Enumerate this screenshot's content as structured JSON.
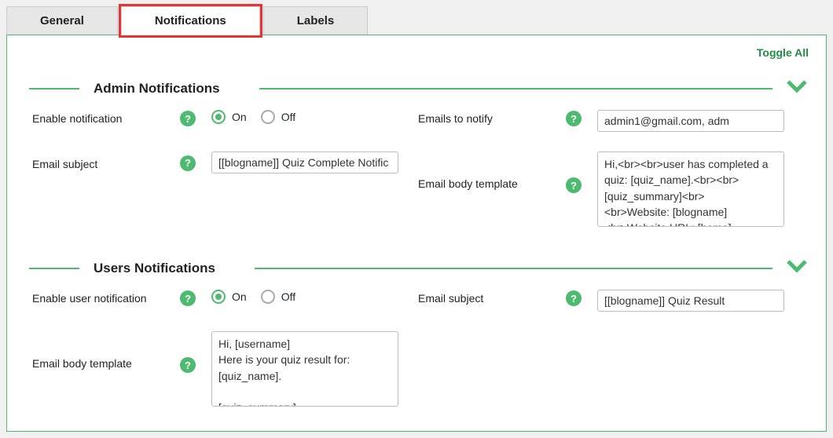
{
  "tabs": {
    "general": "General",
    "notifications": "Notifications",
    "labels": "Labels"
  },
  "toggle_all": "Toggle All",
  "radio": {
    "on": "On",
    "off": "Off"
  },
  "help_glyph": "?",
  "admin": {
    "title": "Admin Notifications",
    "enable_label": "Enable notification",
    "emails_label": "Emails to notify",
    "emails_value": "admin1@gmail.com, adm",
    "subject_label": "Email subject",
    "subject_value": "[[blogname]] Quiz Complete Notific",
    "body_label": "Email body template",
    "body_value": "Hi,<br><br>user has completed a quiz: [quiz_name].<br><br>[quiz_summary]<br>\n<br>Website: [blogname]\n<br>Website URL: [home]"
  },
  "users": {
    "title": "Users Notifications",
    "enable_label": "Enable user notification",
    "subject_label": "Email subject",
    "subject_value": "[[blogname]] Quiz Result",
    "body_label": "Email body template",
    "body_value": "Hi, [username]\nHere is your quiz result for: [quiz_name].\n\n[quiz_summary]"
  }
}
